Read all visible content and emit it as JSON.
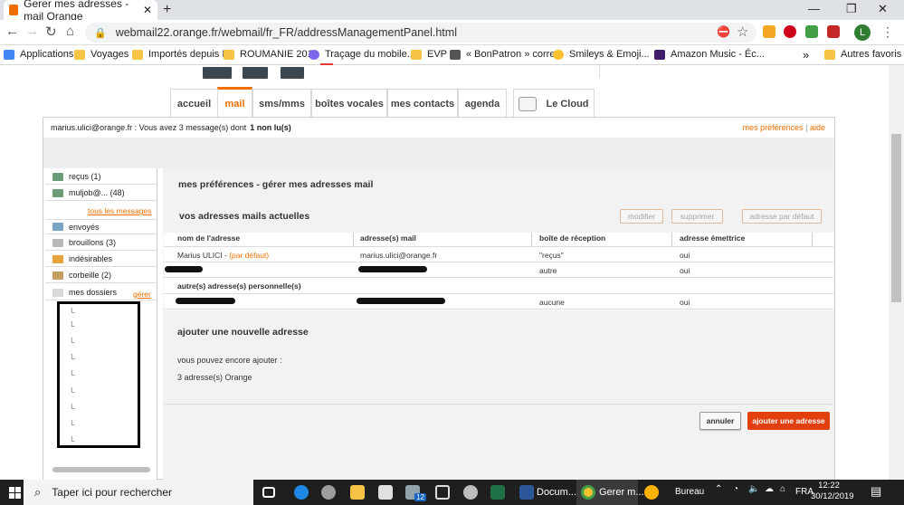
{
  "browser": {
    "tab_title": "Gerer mes adresses -mail Orange",
    "tab_close": "✕",
    "new_tab": "+",
    "url": "webmail22.orange.fr/webmail/fr_FR/addressManagementPanel.html",
    "profile_initial": "L",
    "window_buttons": [
      "—",
      "❐",
      "✕"
    ]
  },
  "bookmarks": {
    "items": [
      "Applications",
      "Voyages",
      "Importés depuis IE",
      "ROUMANIE 2018",
      "Traçage du mobile...",
      "EVP",
      "« BonPatron » corre...",
      "Smileys & Emoji...",
      "Amazon Music - Éc..."
    ],
    "more": "»",
    "other": "Autres favoris"
  },
  "nav_tabs": [
    "accueil",
    "mail",
    "sms/mms",
    "boîtes vocales",
    "mes contacts",
    "agenda",
    "Le Cloud"
  ],
  "info": {
    "text": "marius.ulici@orange.fr : Vous avez 3 message(s) dont",
    "unread": "1 non lu(s)",
    "prefs": "mes préférences",
    "sep": "|",
    "help": "aide"
  },
  "sidebar": {
    "items": [
      "reçus (1)",
      "muljob@... (48)",
      "envoyés",
      "brouillons (3)",
      "indésirables",
      "corbeille (2)",
      "mes dossiers"
    ],
    "all_messages": "tous les messages",
    "manage": "gérer",
    "folder_prefix": "└"
  },
  "content": {
    "page_title": "mes préférences - gérer mes adresses mail",
    "section_current": "vos adresses mails actuelles",
    "buttons": {
      "modify": "modifier",
      "delete": "supprimer",
      "default": "adresse par défaut"
    },
    "columns": [
      "nom de l'adresse",
      "adresse(s) mail",
      "boîte de réception",
      "adresse émettrice"
    ],
    "row1": {
      "name": "Marius ULICI",
      "sep": "-",
      "default": "(par défaut)",
      "mail": "marius.ulici@orange.fr",
      "box": "\"reçus\"",
      "sender": "oui"
    },
    "row2": {
      "box": "autre",
      "sender": "oui"
    },
    "personal_header": "autre(s) adresse(s) personnelle(s)",
    "row3": {
      "box": "aucune",
      "sender": "oui"
    },
    "section_add": "ajouter une nouvelle adresse",
    "can_add": "vous pouvez encore ajouter :",
    "remaining": "3 adresse(s) Orange",
    "cancel": "annuler",
    "add": "ajouter une adresse"
  },
  "taskbar": {
    "search_placeholder": "Taper ici pour rechercher",
    "doc_label": "Docum...",
    "chrome_label": "Gerer m...",
    "desktop_label": "Bureau",
    "lang": "FRA",
    "time": "12:22",
    "date": "30/12/2019",
    "badge": "12"
  },
  "colors": {
    "orange": "#f16e00",
    "add_button": "#e3400f",
    "taskbar": "#1f1f1f"
  }
}
